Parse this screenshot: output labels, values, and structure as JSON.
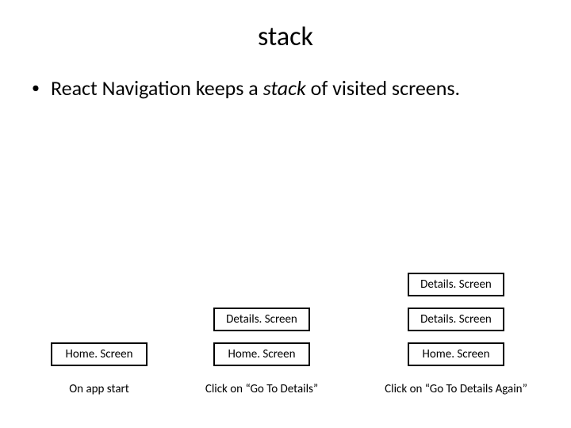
{
  "title": "stack",
  "bullet": {
    "prefix": "React Navigation keeps a ",
    "italic": "stack",
    "suffix": " of visited screens."
  },
  "columns": [
    {
      "screens": [
        "Home. Screen"
      ],
      "caption": "On app start"
    },
    {
      "screens": [
        "Details. Screen",
        "Home. Screen"
      ],
      "caption": "Click on “Go To Details”"
    },
    {
      "screens": [
        "Details. Screen",
        "Details. Screen",
        "Home. Screen"
      ],
      "caption": "Click on “Go To Details Again”"
    }
  ]
}
